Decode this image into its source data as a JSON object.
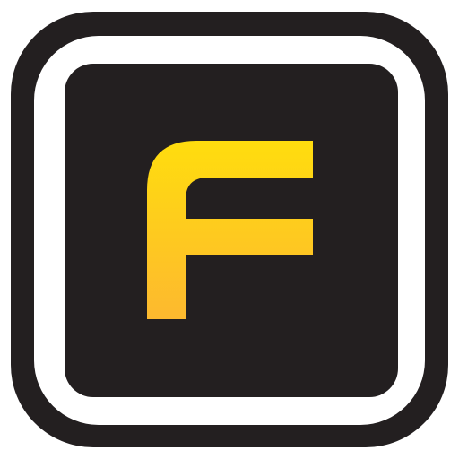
{
  "icon": {
    "name": "app-icon",
    "logo_letter": "F",
    "colors": {
      "outer_frame": "#231f20",
      "gap_ring": "#ffffff",
      "inner_tile": "#231f20",
      "letter_gradient_top": "#ffdd0e",
      "letter_gradient_bottom": "#fdb92f"
    }
  }
}
